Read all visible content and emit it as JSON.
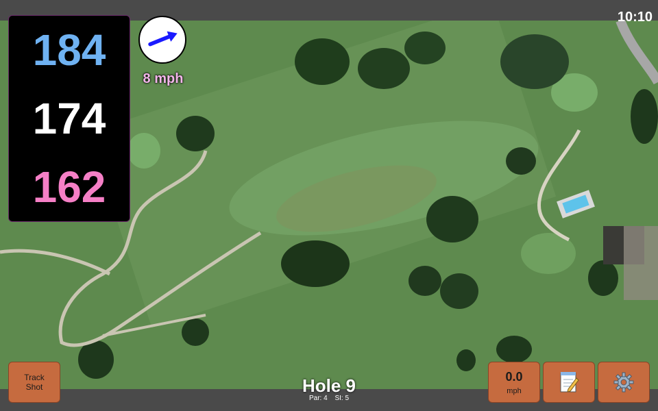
{
  "status": {
    "time": "10:10"
  },
  "distances": {
    "back": "184",
    "middle": "174",
    "front": "162"
  },
  "wind": {
    "speed_label": "8 mph",
    "direction_icon": "wind-arrow-icon"
  },
  "buttons": {
    "track_shot_line1": "Track",
    "track_shot_line2": "Shot",
    "speed_value": "0.0",
    "speed_unit": "mph",
    "notes_icon": "notepad-icon",
    "settings_icon": "gear-icon"
  },
  "hole": {
    "title": "Hole 9",
    "par": "Par: 4",
    "si": "SI: 5"
  },
  "colors": {
    "back": "#6fb2f2",
    "middle": "#ffffff",
    "front": "#f57fc6",
    "button": "#c66b3f",
    "wind_arrow": "#1a1aff"
  }
}
